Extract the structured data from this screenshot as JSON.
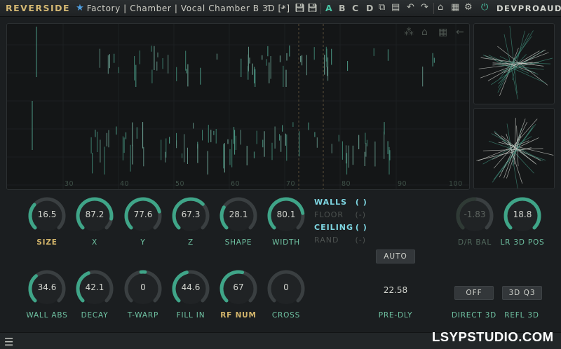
{
  "header": {
    "brand": "REVERSIDE",
    "preset_path": "Factory | Chamber | Vocal Chamber B 3D [*]",
    "ab_slots": [
      "A",
      "B",
      "C",
      "D"
    ],
    "active_slot": "A",
    "vendor": "DEVPROAUDIO",
    "icons": [
      "star-icon",
      "chevron-up-icon",
      "chevron-down-icon",
      "save-icon",
      "save-as-icon",
      "copy-icon",
      "paste-icon",
      "undo-icon",
      "redo-icon",
      "home-icon",
      "grid-icon",
      "power-icon"
    ]
  },
  "display": {
    "x_ticks": [
      "30",
      "40",
      "50",
      "60",
      "70",
      "80",
      "90",
      "100"
    ],
    "view_icons": [
      "nodes-icon",
      "home-icon",
      "grid-icon",
      "back-arrow-icon"
    ]
  },
  "knobs_row1": [
    {
      "value": "16.5",
      "label": "SIZE",
      "level": 0.32
    },
    {
      "value": "87.2",
      "label": "X",
      "level": 0.87
    },
    {
      "value": "77.6",
      "label": "Y",
      "level": 0.78
    },
    {
      "value": "67.3",
      "label": "Z",
      "level": 0.67
    },
    {
      "value": "28.1",
      "label": "SHAPE",
      "level": 0.28
    },
    {
      "value": "80.1",
      "label": "WIDTH",
      "level": 0.8
    }
  ],
  "knobs_row2": [
    {
      "value": "34.6",
      "label": "WALL ABS",
      "level": 0.35
    },
    {
      "value": "42.1",
      "label": "DECAY",
      "level": 0.42
    },
    {
      "value": "0",
      "label": "T-WARP",
      "level": 0.5
    },
    {
      "value": "44.6",
      "label": "FILL IN",
      "level": 0.45
    },
    {
      "value": "67",
      "label": "RF NUM",
      "level": 0.55
    },
    {
      "value": "0",
      "label": "CROSS",
      "level": 0.0
    }
  ],
  "toggles": [
    {
      "name": "WALLS",
      "state": "( )",
      "on": true
    },
    {
      "name": "FLOOR",
      "state": "(-)",
      "on": false
    },
    {
      "name": "CEILING",
      "state": "( )",
      "on": true
    },
    {
      "name": "RAND",
      "state": "(-)",
      "on": false
    }
  ],
  "pre_delay": {
    "auto_label": "AUTO",
    "value": "22.58",
    "label": "PRE-DLY"
  },
  "right_knobs": [
    {
      "value": "-1.83",
      "label": "D/R BAL",
      "level": 0.5
    },
    {
      "value": "18.8",
      "label": "LR 3D POS",
      "level": 1.0
    }
  ],
  "direct_3d": {
    "button": "OFF",
    "label": "DIRECT 3D"
  },
  "refl_3d": {
    "button": "3D Q3",
    "label": "REFL 3D"
  },
  "bottom": {
    "menu_icon": "hamburger-menu-icon"
  },
  "watermark": "LSYPSTUDIO.COM",
  "colors": {
    "accent": "#3fa588",
    "gold": "#d2b46a",
    "teal_text": "#6fc2a2"
  }
}
